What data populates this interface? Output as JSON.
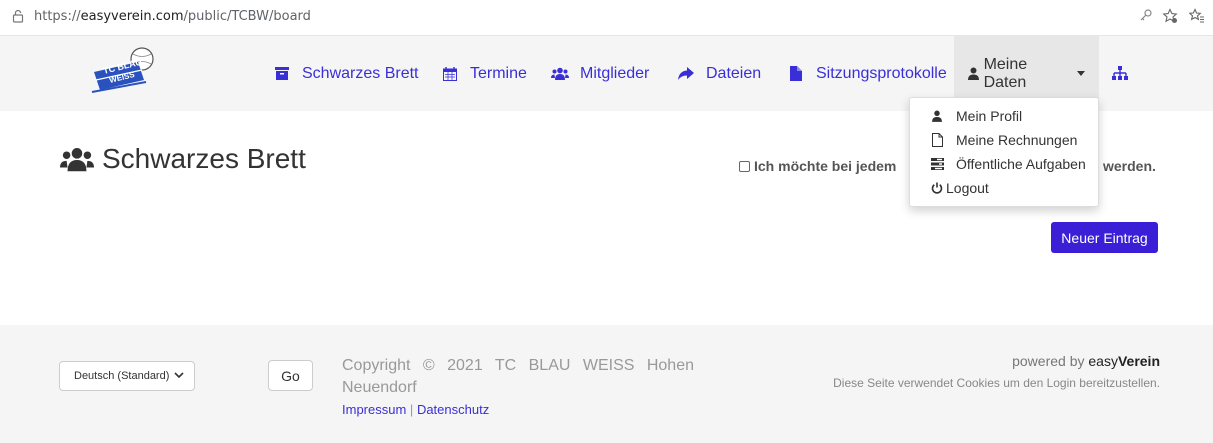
{
  "browser": {
    "url_prefix": "https://",
    "url_domain": "easyverein.com",
    "url_path": "/public/TCBW/board"
  },
  "nav": {
    "items": [
      {
        "label": "Schwarzes Brett",
        "icon": "archive-icon"
      },
      {
        "label": "Termine",
        "icon": "calendar-icon"
      },
      {
        "label": "Mitglieder",
        "icon": "users-icon"
      },
      {
        "label": "Dateien",
        "icon": "share-icon"
      },
      {
        "label": "Sitzungsprotokolle",
        "icon": "file-icon"
      }
    ],
    "account": {
      "label": "Meine Daten",
      "icon": "user-icon"
    },
    "extra_icon": "sitemap-icon",
    "logo_text": "TC BLAU WEISS"
  },
  "dropdown": {
    "items": [
      {
        "label": "Mein Profil",
        "icon": "user-icon"
      },
      {
        "label": "Meine Rechnungen",
        "icon": "file-outline-icon"
      },
      {
        "label": "Öffentliche Aufgaben",
        "icon": "tasks-icon"
      },
      {
        "label": "Logout",
        "icon": "power-icon"
      }
    ]
  },
  "main": {
    "title": "Schwarzes Brett",
    "notify_text_start": "Ich möchte bei jedem",
    "notify_text_end": "werden.",
    "new_entry_button": "Neuer Eintrag"
  },
  "footer": {
    "language": "Deutsch (Standard)",
    "go_button": "Go",
    "copyright": "Copyright © 2021 TC BLAU WEISS Hohen Neuendorf",
    "impressum": "Impressum",
    "separator": "|",
    "datenschutz": "Datenschutz",
    "powered_by": "powered by",
    "brand_easy": "easy",
    "brand_verein": "Verein",
    "cookies_note": "Diese Seite verwendet Cookies um den Login bereitzustellen."
  },
  "colors": {
    "accent": "#3a2fd6",
    "button": "#3a1fd6",
    "navbar_bg": "#f5f5f5"
  }
}
